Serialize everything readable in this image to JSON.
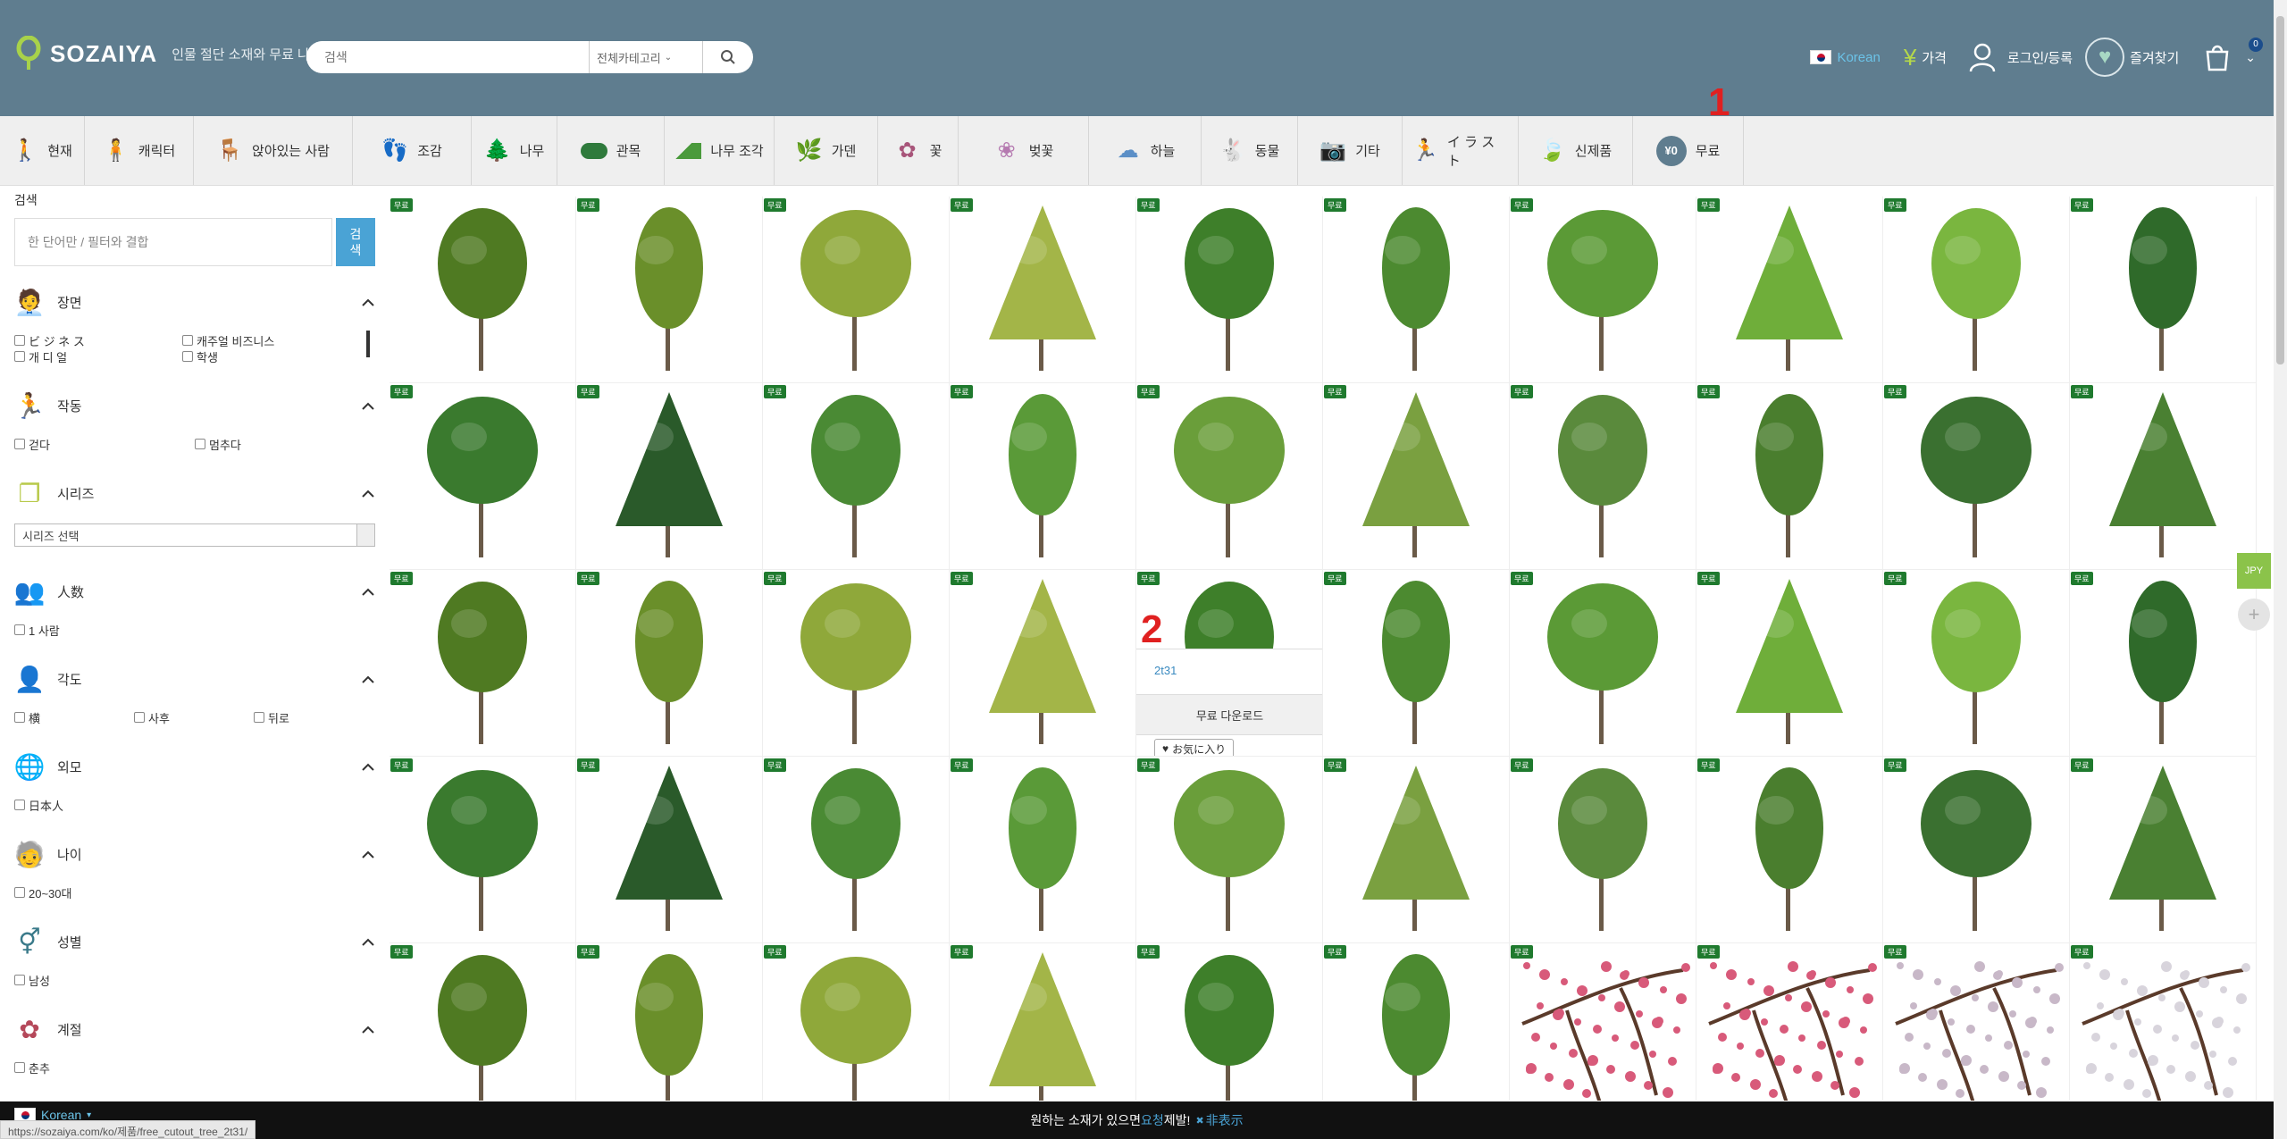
{
  "header": {
    "logo_text": "SOZAIYA",
    "tagline": "인물 절단 소재와 무료 나무",
    "search_placeholder": "검색",
    "category_select": "전체카테고리",
    "language": "Korean",
    "price_label": "가격",
    "login_label": "로그인/등록",
    "favorites_label": "즐겨찾기",
    "cart_count": "0"
  },
  "categories": [
    {
      "label": "현재",
      "icon": "person-icon"
    },
    {
      "label": "캐릭터",
      "icon": "character-icon"
    },
    {
      "label": "앉아있는 사람",
      "icon": "sitting-person-icon"
    },
    {
      "label": "조감",
      "icon": "walking-people-icon"
    },
    {
      "label": "나무",
      "icon": "tree-icon"
    },
    {
      "label": "관목",
      "icon": "shrub-icon"
    },
    {
      "label": "나무 조각",
      "icon": "hedge-icon"
    },
    {
      "label": "가덴",
      "icon": "garden-plant-icon"
    },
    {
      "label": "꽃",
      "icon": "flower-icon"
    },
    {
      "label": "벚꽃",
      "icon": "cherry-blossom-icon"
    },
    {
      "label": "하늘",
      "icon": "cloud-icon"
    },
    {
      "label": "동물",
      "icon": "animal-icon"
    },
    {
      "label": "기타",
      "icon": "camera-icon"
    },
    {
      "label": "イ ラ ス ト",
      "icon": "illustration-person-icon"
    },
    {
      "label": "신제품",
      "icon": "leaf-icon"
    },
    {
      "label": "무료",
      "icon": "yen-zero-icon",
      "badge": "¥0"
    }
  ],
  "annotations": {
    "one": "1",
    "two": "2"
  },
  "sidebar": {
    "title": "검색",
    "search_placeholder": "한 단어만 / 필터와 결합",
    "search_button": "검색",
    "sections": [
      {
        "title": "장면",
        "icon": "scene-icon",
        "options": [
          "ビ ジ ネ ス",
          "캐주얼 비즈니스",
          "개 디 얼",
          "학생"
        ]
      },
      {
        "title": "작동",
        "icon": "action-icon",
        "options": [
          "걷다",
          "멈추다"
        ]
      },
      {
        "title": "시리즈",
        "icon": "series-icon",
        "select": "시리즈 선택"
      },
      {
        "title": "人数",
        "icon": "people-count-icon",
        "options": [
          "1 사람"
        ]
      },
      {
        "title": "각도",
        "icon": "angle-icon",
        "options": [
          "横",
          "사후",
          "뒤로"
        ]
      },
      {
        "title": "외모",
        "icon": "globe-icon",
        "options": [
          "日本人"
        ]
      },
      {
        "title": "나이",
        "icon": "age-icon",
        "options": [
          "20~30대"
        ]
      },
      {
        "title": "성별",
        "icon": "gender-icon",
        "options": [
          "남성"
        ]
      },
      {
        "title": "계절",
        "icon": "season-flower-icon",
        "options": [
          "춘추"
        ]
      }
    ]
  },
  "grid": {
    "badge_label": "무료",
    "hover_item": {
      "name": "2t31",
      "download_label": "무료 다운로드",
      "favorite_label": "お気に入り"
    }
  },
  "side": {
    "currency": "JPY",
    "plus": "+"
  },
  "bottom": {
    "language": "Korean",
    "text_before": "원하는 소재가 있으면",
    "request_link": "요청",
    "text_after": "제발!",
    "hide_label": "非表示",
    "status_url": "https://sozaiya.com/ko/제품/free_cutout_tree_2t31/"
  },
  "colors": {
    "header_bg": "#5f7d8f",
    "accent_blue": "#4aa3d5",
    "free_badge": "#1f7a2e",
    "annotation_red": "#e02020"
  }
}
